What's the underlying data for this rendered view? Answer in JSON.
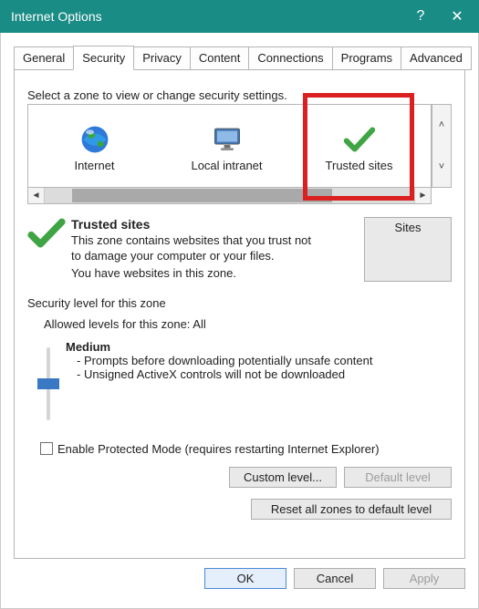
{
  "window": {
    "title": "Internet Options",
    "help_glyph": "?",
    "close_glyph": "✕"
  },
  "tabs": [
    {
      "label": "General"
    },
    {
      "label": "Security"
    },
    {
      "label": "Privacy"
    },
    {
      "label": "Content"
    },
    {
      "label": "Connections"
    },
    {
      "label": "Programs"
    },
    {
      "label": "Advanced"
    }
  ],
  "active_tab_index": 1,
  "security": {
    "instruction": "Select a zone to view or change security settings.",
    "zones": [
      {
        "label": "Internet",
        "icon": "globe-icon"
      },
      {
        "label": "Local intranet",
        "icon": "monitor-icon"
      },
      {
        "label": "Trusted sites",
        "icon": "check-icon"
      }
    ],
    "selected_zone_index": 2,
    "sites_button": "Sites",
    "zone_title": "Trusted sites",
    "zone_desc_line1": "This zone contains websites that you trust not to damage your computer or your files.",
    "zone_desc_line2": "You have websites in this zone.",
    "level_heading": "Security level for this zone",
    "allowed_levels": "Allowed levels for this zone: All",
    "slider": {
      "level_name": "Medium",
      "lines": [
        "- Prompts before downloading potentially unsafe content",
        "- Unsigned ActiveX controls will not be downloaded"
      ]
    },
    "protected_mode_label": "Enable Protected Mode (requires restarting Internet Explorer)",
    "protected_mode_checked": false,
    "custom_level_btn": "Custom level...",
    "default_level_btn": "Default level",
    "reset_all_btn": "Reset all zones to default level"
  },
  "footer": {
    "ok": "OK",
    "cancel": "Cancel",
    "apply": "Apply"
  }
}
